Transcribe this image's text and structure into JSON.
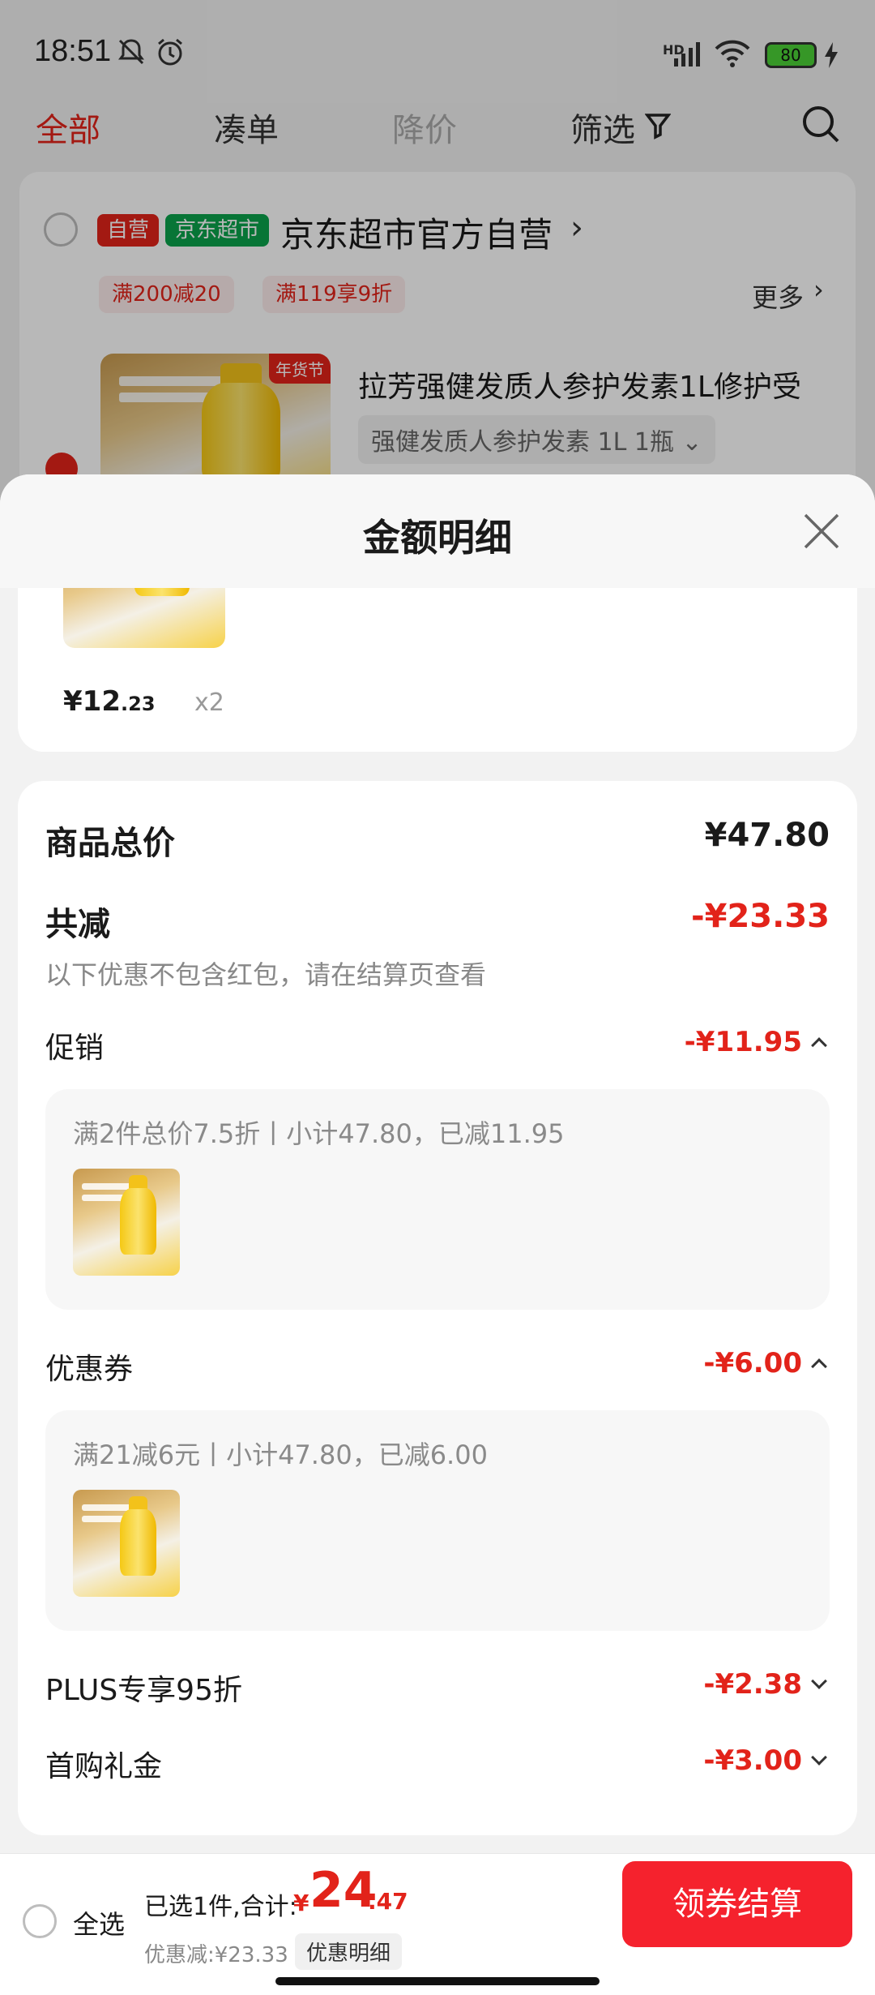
{
  "status_bar": {
    "time": "18:51",
    "battery": "80",
    "network_label": "HD"
  },
  "top_tabs": [
    {
      "label": "全部"
    },
    {
      "label": "凑单"
    },
    {
      "label": "降价"
    },
    {
      "label": "筛选"
    }
  ],
  "store": {
    "badge_self": "自营",
    "badge_supermarket": "京东超市",
    "name": "京东超市官方自营",
    "promo_tags": [
      "满200减20",
      "满119享9折"
    ],
    "more_label": "更多",
    "product_title": "拉芳强健发质人参护发素1L修护受",
    "product_sku": "强健发质人参护发素 1L 1瓶",
    "product_badge": "年货节"
  },
  "sheet": {
    "title": "金额明细",
    "item_price_symbol": "¥",
    "item_price_int": "12",
    "item_price_dec": ".23",
    "item_qty": "x2",
    "total_label": "商品总价",
    "total_value": "¥47.80",
    "discount_label": "共减",
    "discount_value": "-¥23.33",
    "discount_note": "以下优惠不包含红包，请在结算页查看",
    "sections": [
      {
        "label": "促销",
        "value": "-¥11.95",
        "expanded": true,
        "detail": "满2件总价7.5折丨小计47.80，已减11.95"
      },
      {
        "label": "优惠券",
        "value": "-¥6.00",
        "expanded": true,
        "detail": "满21减6元丨小计47.80，已减6.00"
      },
      {
        "label": "PLUS专享95折",
        "value": "-¥2.38",
        "expanded": false
      },
      {
        "label": "首购礼金",
        "value": "-¥3.00",
        "expanded": false
      }
    ]
  },
  "bottom_bar": {
    "select_all": "全选",
    "selected_text": "已选1件,合计:",
    "total_symbol": "¥",
    "total_int": "24",
    "total_dec": ".47",
    "saved_text": "优惠减:¥23.33",
    "detail_button": "优惠明细",
    "checkout_button": "领券结算"
  },
  "colors": {
    "accent": "#e2231a",
    "checkout": "#f5222d",
    "supermarket_green": "#0aa34c"
  }
}
